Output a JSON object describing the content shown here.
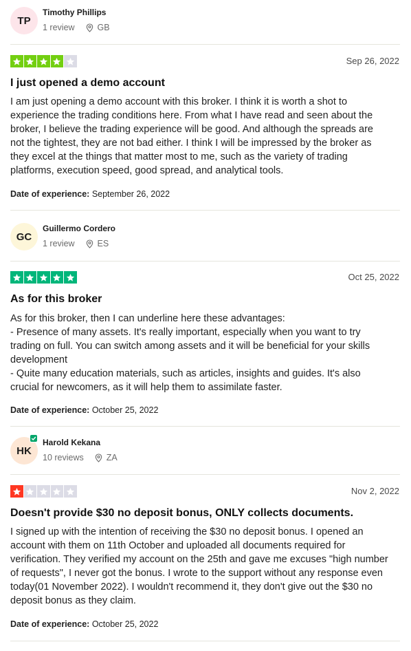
{
  "reviews": [
    {
      "initials": "TP",
      "avatar_color": "#fde5ea",
      "name": "Timothy Phillips",
      "reviews_count": "1 review",
      "country": "GB",
      "rating": 4,
      "star_color": "#73cf11",
      "date": "Sep 26, 2022",
      "title": "I just opened a demo account",
      "body": "I am just opening a demo account with this broker. I think it is worth a shot to\nexperience the trading conditions here. From what I have read and seen about the\nbroker, I believe the trading experience will be good. And although the spreads are\nnot the tightest, they are not bad either. I think I will be impressed by the broker as\nthey excel at the things that matter most to me, such as the variety of trading\nplatforms, execution speed, good spread, and analytical tools.",
      "exp_label": "Date of experience:",
      "exp_date": "September 26, 2022"
    },
    {
      "initials": "GC",
      "avatar_color": "#fdf6d9",
      "name": "Guillermo Cordero",
      "reviews_count": "1 review",
      "country": "ES",
      "rating": 5,
      "star_color": "#00b67a",
      "date": "Oct 25, 2022",
      "title": "As for this broker",
      "body": "As for this broker, then I can underline here these advantages:\n- Presence of many assets. It's really important, especially when you want to try\ntrading on full. You can switch among assets and it will be beneficial for your skills\ndevelopment\n- Quite many education materials, such as articles, insights and guides. It's also\ncrucial for newcomers, as it will help them to assimilate faster.",
      "exp_label": "Date of experience:",
      "exp_date": "October 25, 2022"
    },
    {
      "initials": "HK",
      "avatar_color": "#fde6d4",
      "name": "Harold Kekana",
      "reviews_count": "10 reviews",
      "country": "ZA",
      "rating": 1,
      "star_color": "#ff3722",
      "date": "Nov 2, 2022",
      "title": "Doesn't provide $30 no deposit bonus, ONLY collects documents.",
      "body": "I signed up with the intention of receiving the $30 no deposit bonus. I opened an\naccount with them on 11th October and uploaded all documents required for\nverification. They verified my account on the 25th and gave me excuses \"high number\nof requests\", I never got the bonus. I wrote to the support without any response even\ntoday(01 November 2022). I wouldn't recommend it, they don't give out the $30 no\ndeposit bonus as they claim.",
      "exp_label": "Date of experience:",
      "exp_date": "October 25, 2022"
    }
  ]
}
